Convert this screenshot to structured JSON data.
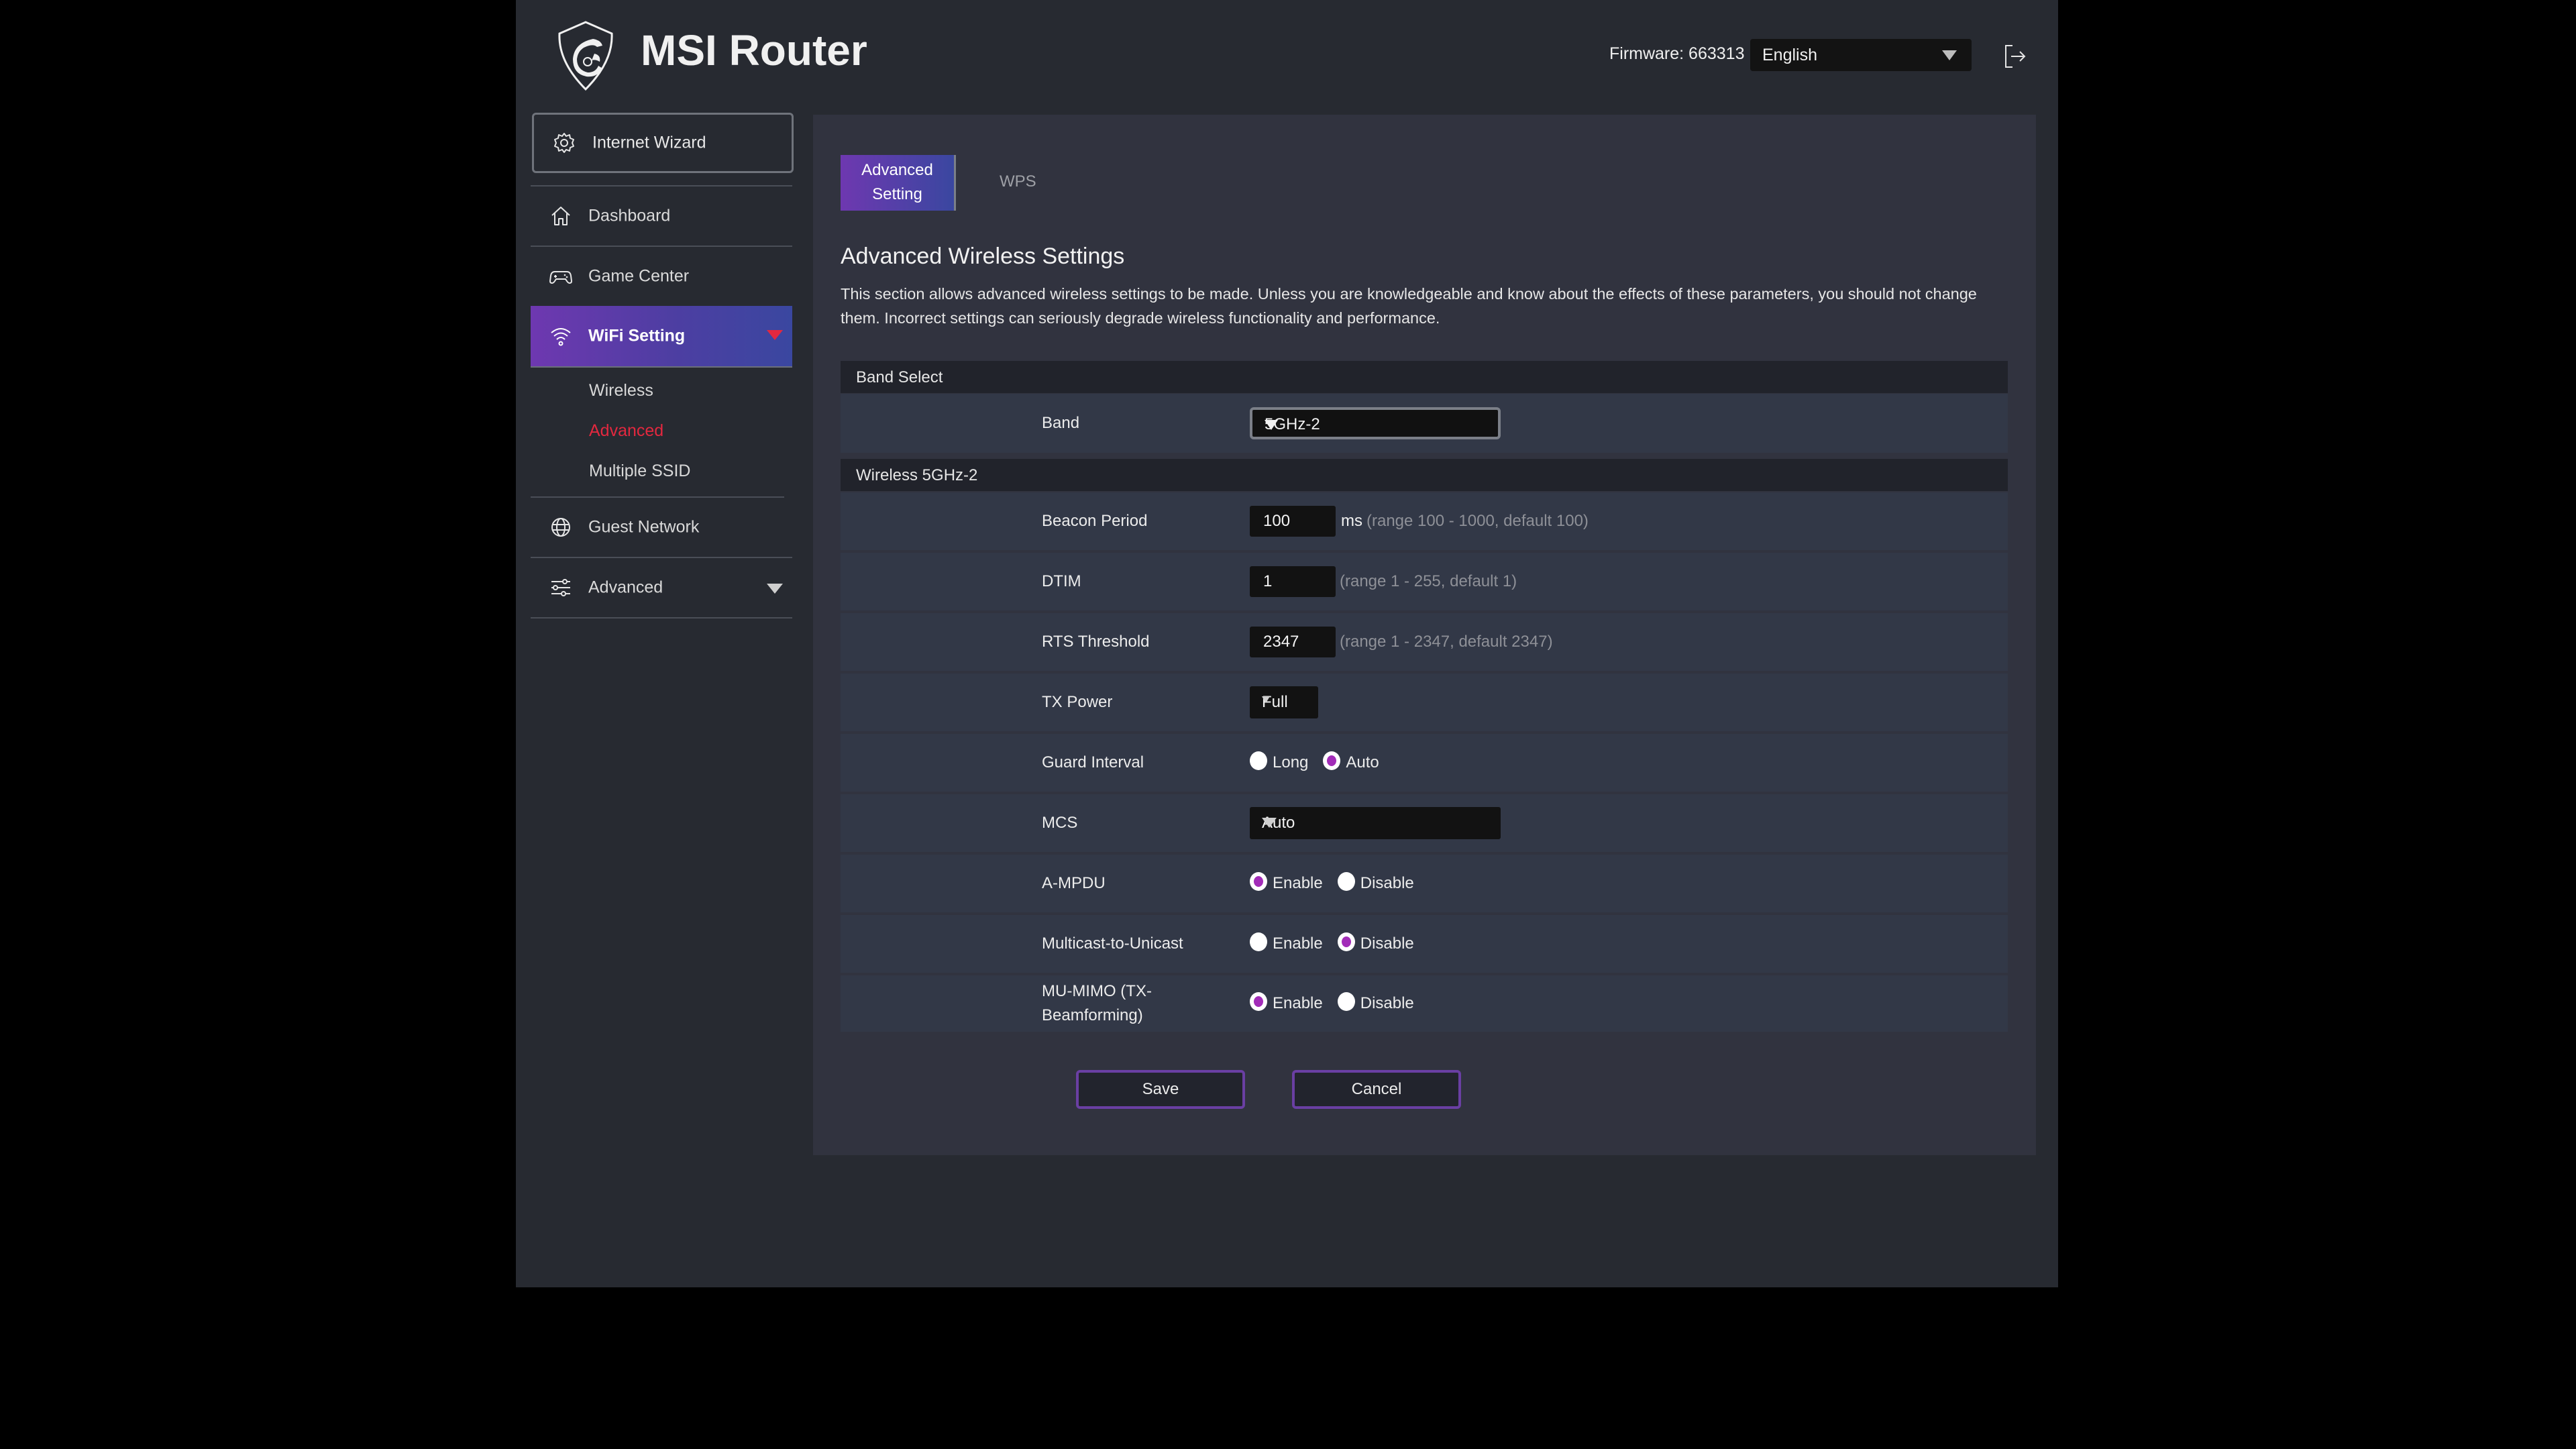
{
  "header": {
    "brand": "MSI Router",
    "firmware_label": "Firmware: 663313",
    "language": "English"
  },
  "sidebar": {
    "wizard": "Internet Wizard",
    "items": [
      {
        "label": "Dashboard",
        "icon": "home-icon"
      },
      {
        "label": "Game Center",
        "icon": "gamepad-icon"
      },
      {
        "label": "WiFi Setting",
        "icon": "wifi-icon",
        "active": true,
        "expanded": true
      },
      {
        "label": "Guest Network",
        "icon": "globe-icon"
      },
      {
        "label": "Advanced",
        "icon": "sliders-icon",
        "expandable": true
      }
    ],
    "wifi_sub": [
      {
        "label": "Wireless"
      },
      {
        "label": "Advanced",
        "active": true
      },
      {
        "label": "Multiple SSID"
      }
    ]
  },
  "tabs": [
    {
      "label": "Advanced Setting",
      "active": true
    },
    {
      "label": "WPS",
      "active": false
    }
  ],
  "main": {
    "title": "Advanced Wireless Settings",
    "description": "This section allows advanced wireless settings to be made. Unless you are knowledgeable and know about the effects of these parameters, you should not change them. Incorrect settings can seriously degrade wireless functionality and performance.",
    "band_section": "Band Select",
    "band_label": "Band",
    "band_value": "5GHz-2",
    "wireless_section": "Wireless 5GHz-2",
    "beacon": {
      "label": "Beacon Period",
      "value": "100",
      "unit": "ms",
      "hint": "(range 100 - 1000, default 100)"
    },
    "dtim": {
      "label": "DTIM",
      "value": "1",
      "hint": "(range 1 - 255, default 1)"
    },
    "rts": {
      "label": "RTS Threshold",
      "value": "2347",
      "hint": "(range 1 - 2347, default 2347)"
    },
    "tx_power": {
      "label": "TX Power",
      "value": "Full"
    },
    "guard_interval": {
      "label": "Guard Interval",
      "options": [
        "Long",
        "Auto"
      ],
      "selected": "Auto"
    },
    "mcs": {
      "label": "MCS",
      "value": "Auto"
    },
    "ampdu": {
      "label": "A-MPDU",
      "options": [
        "Enable",
        "Disable"
      ],
      "selected": "Enable"
    },
    "m2u": {
      "label": "Multicast-to-Unicast",
      "options": [
        "Enable",
        "Disable"
      ],
      "selected": "Disable"
    },
    "mumimo": {
      "label": "MU-MIMO (TX-Beamforming)",
      "options": [
        "Enable",
        "Disable"
      ],
      "selected": "Enable"
    },
    "save": "Save",
    "cancel": "Cancel"
  },
  "colors": {
    "accent_gradient_start": "#6e38b0",
    "accent_gradient_end": "#3a47a0",
    "active_red": "#e3283f",
    "radio_selected": "#a22cb8"
  }
}
